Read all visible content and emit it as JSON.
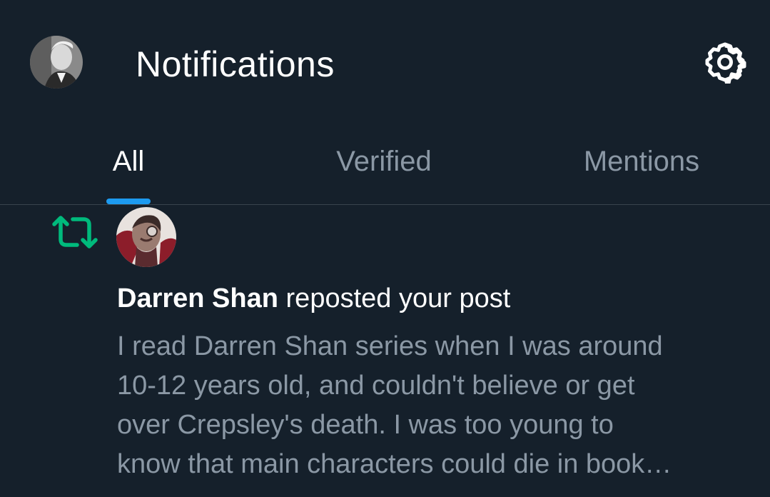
{
  "header": {
    "title": "Notifications",
    "avatar_icon": "user-avatar-portrait",
    "settings_icon": "gear-icon"
  },
  "tabs": [
    {
      "label": "All",
      "active": true
    },
    {
      "label": "Verified",
      "active": false
    },
    {
      "label": "Mentions",
      "active": false
    }
  ],
  "notification": {
    "type_icon": "repost-icon",
    "actor_name": "Darren Shan",
    "action": "reposted your post",
    "preview_lines": [
      "I read Darren Shan series when I was around",
      "10-12 years old, and couldn't believe or get",
      "over Crepsley's death. I was too young to",
      "know that main characters could die in book…"
    ]
  },
  "colors": {
    "background": "#15202b",
    "accent": "#1d9bf0",
    "repost": "#00ba7c",
    "muted_text": "#8b98a5",
    "divider": "#38444d"
  }
}
